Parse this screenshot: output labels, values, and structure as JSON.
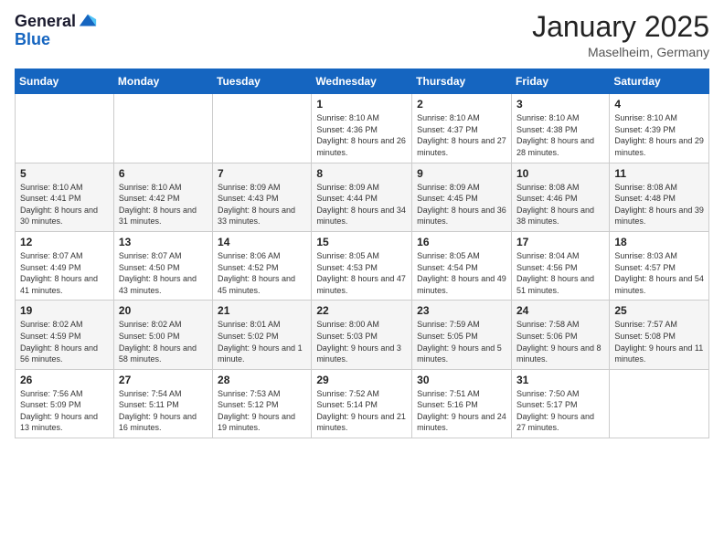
{
  "logo": {
    "general": "General",
    "blue": "Blue"
  },
  "header": {
    "month": "January 2025",
    "location": "Maselheim, Germany"
  },
  "weekdays": [
    "Sunday",
    "Monday",
    "Tuesday",
    "Wednesday",
    "Thursday",
    "Friday",
    "Saturday"
  ],
  "weeks": [
    [
      {
        "day": "",
        "sunrise": "",
        "sunset": "",
        "daylight": ""
      },
      {
        "day": "",
        "sunrise": "",
        "sunset": "",
        "daylight": ""
      },
      {
        "day": "",
        "sunrise": "",
        "sunset": "",
        "daylight": ""
      },
      {
        "day": "1",
        "sunrise": "Sunrise: 8:10 AM",
        "sunset": "Sunset: 4:36 PM",
        "daylight": "Daylight: 8 hours and 26 minutes."
      },
      {
        "day": "2",
        "sunrise": "Sunrise: 8:10 AM",
        "sunset": "Sunset: 4:37 PM",
        "daylight": "Daylight: 8 hours and 27 minutes."
      },
      {
        "day": "3",
        "sunrise": "Sunrise: 8:10 AM",
        "sunset": "Sunset: 4:38 PM",
        "daylight": "Daylight: 8 hours and 28 minutes."
      },
      {
        "day": "4",
        "sunrise": "Sunrise: 8:10 AM",
        "sunset": "Sunset: 4:39 PM",
        "daylight": "Daylight: 8 hours and 29 minutes."
      }
    ],
    [
      {
        "day": "5",
        "sunrise": "Sunrise: 8:10 AM",
        "sunset": "Sunset: 4:41 PM",
        "daylight": "Daylight: 8 hours and 30 minutes."
      },
      {
        "day": "6",
        "sunrise": "Sunrise: 8:10 AM",
        "sunset": "Sunset: 4:42 PM",
        "daylight": "Daylight: 8 hours and 31 minutes."
      },
      {
        "day": "7",
        "sunrise": "Sunrise: 8:09 AM",
        "sunset": "Sunset: 4:43 PM",
        "daylight": "Daylight: 8 hours and 33 minutes."
      },
      {
        "day": "8",
        "sunrise": "Sunrise: 8:09 AM",
        "sunset": "Sunset: 4:44 PM",
        "daylight": "Daylight: 8 hours and 34 minutes."
      },
      {
        "day": "9",
        "sunrise": "Sunrise: 8:09 AM",
        "sunset": "Sunset: 4:45 PM",
        "daylight": "Daylight: 8 hours and 36 minutes."
      },
      {
        "day": "10",
        "sunrise": "Sunrise: 8:08 AM",
        "sunset": "Sunset: 4:46 PM",
        "daylight": "Daylight: 8 hours and 38 minutes."
      },
      {
        "day": "11",
        "sunrise": "Sunrise: 8:08 AM",
        "sunset": "Sunset: 4:48 PM",
        "daylight": "Daylight: 8 hours and 39 minutes."
      }
    ],
    [
      {
        "day": "12",
        "sunrise": "Sunrise: 8:07 AM",
        "sunset": "Sunset: 4:49 PM",
        "daylight": "Daylight: 8 hours and 41 minutes."
      },
      {
        "day": "13",
        "sunrise": "Sunrise: 8:07 AM",
        "sunset": "Sunset: 4:50 PM",
        "daylight": "Daylight: 8 hours and 43 minutes."
      },
      {
        "day": "14",
        "sunrise": "Sunrise: 8:06 AM",
        "sunset": "Sunset: 4:52 PM",
        "daylight": "Daylight: 8 hours and 45 minutes."
      },
      {
        "day": "15",
        "sunrise": "Sunrise: 8:05 AM",
        "sunset": "Sunset: 4:53 PM",
        "daylight": "Daylight: 8 hours and 47 minutes."
      },
      {
        "day": "16",
        "sunrise": "Sunrise: 8:05 AM",
        "sunset": "Sunset: 4:54 PM",
        "daylight": "Daylight: 8 hours and 49 minutes."
      },
      {
        "day": "17",
        "sunrise": "Sunrise: 8:04 AM",
        "sunset": "Sunset: 4:56 PM",
        "daylight": "Daylight: 8 hours and 51 minutes."
      },
      {
        "day": "18",
        "sunrise": "Sunrise: 8:03 AM",
        "sunset": "Sunset: 4:57 PM",
        "daylight": "Daylight: 8 hours and 54 minutes."
      }
    ],
    [
      {
        "day": "19",
        "sunrise": "Sunrise: 8:02 AM",
        "sunset": "Sunset: 4:59 PM",
        "daylight": "Daylight: 8 hours and 56 minutes."
      },
      {
        "day": "20",
        "sunrise": "Sunrise: 8:02 AM",
        "sunset": "Sunset: 5:00 PM",
        "daylight": "Daylight: 8 hours and 58 minutes."
      },
      {
        "day": "21",
        "sunrise": "Sunrise: 8:01 AM",
        "sunset": "Sunset: 5:02 PM",
        "daylight": "Daylight: 9 hours and 1 minute."
      },
      {
        "day": "22",
        "sunrise": "Sunrise: 8:00 AM",
        "sunset": "Sunset: 5:03 PM",
        "daylight": "Daylight: 9 hours and 3 minutes."
      },
      {
        "day": "23",
        "sunrise": "Sunrise: 7:59 AM",
        "sunset": "Sunset: 5:05 PM",
        "daylight": "Daylight: 9 hours and 5 minutes."
      },
      {
        "day": "24",
        "sunrise": "Sunrise: 7:58 AM",
        "sunset": "Sunset: 5:06 PM",
        "daylight": "Daylight: 9 hours and 8 minutes."
      },
      {
        "day": "25",
        "sunrise": "Sunrise: 7:57 AM",
        "sunset": "Sunset: 5:08 PM",
        "daylight": "Daylight: 9 hours and 11 minutes."
      }
    ],
    [
      {
        "day": "26",
        "sunrise": "Sunrise: 7:56 AM",
        "sunset": "Sunset: 5:09 PM",
        "daylight": "Daylight: 9 hours and 13 minutes."
      },
      {
        "day": "27",
        "sunrise": "Sunrise: 7:54 AM",
        "sunset": "Sunset: 5:11 PM",
        "daylight": "Daylight: 9 hours and 16 minutes."
      },
      {
        "day": "28",
        "sunrise": "Sunrise: 7:53 AM",
        "sunset": "Sunset: 5:12 PM",
        "daylight": "Daylight: 9 hours and 19 minutes."
      },
      {
        "day": "29",
        "sunrise": "Sunrise: 7:52 AM",
        "sunset": "Sunset: 5:14 PM",
        "daylight": "Daylight: 9 hours and 21 minutes."
      },
      {
        "day": "30",
        "sunrise": "Sunrise: 7:51 AM",
        "sunset": "Sunset: 5:16 PM",
        "daylight": "Daylight: 9 hours and 24 minutes."
      },
      {
        "day": "31",
        "sunrise": "Sunrise: 7:50 AM",
        "sunset": "Sunset: 5:17 PM",
        "daylight": "Daylight: 9 hours and 27 minutes."
      },
      {
        "day": "",
        "sunrise": "",
        "sunset": "",
        "daylight": ""
      }
    ]
  ]
}
